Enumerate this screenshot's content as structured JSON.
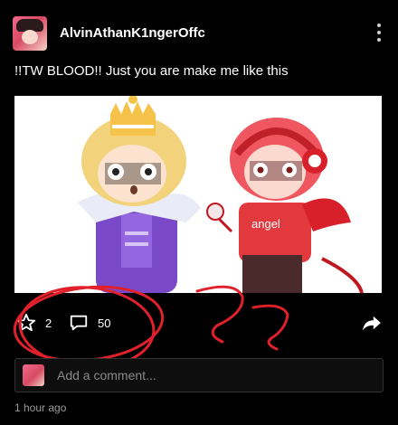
{
  "post": {
    "username": "AlvinAthanK1ngerOffc",
    "caption": "!!TW BLOOD!! Just you are make me like this",
    "time": "1 hour ago"
  },
  "actions": {
    "likes": "2",
    "comments": "50",
    "like_icon": "star-outline-icon",
    "comment_icon": "speech-bubble-icon",
    "share_icon": "share-arrow-icon"
  },
  "comment": {
    "placeholder": "Add a comment..."
  },
  "colors": {
    "background": "#000000",
    "scribble": "#e0202a",
    "character_left_hair": "#f2d27a",
    "character_left_coat": "#7a49c8",
    "character_right_hair": "#f0565f",
    "character_right_shirt": "#e2393f"
  }
}
